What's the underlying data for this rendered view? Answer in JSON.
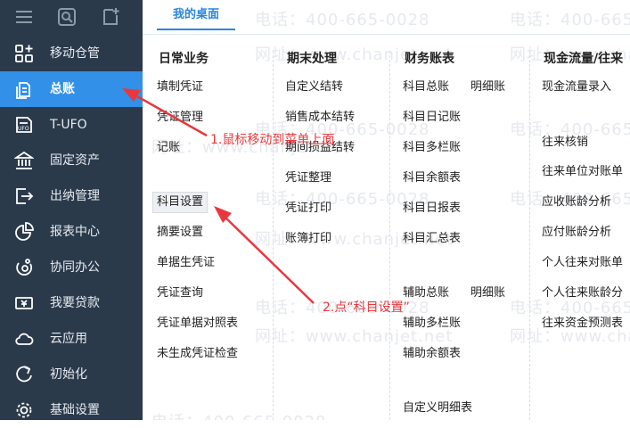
{
  "header": {
    "tab_label": "我的桌面"
  },
  "sidebar": {
    "items": [
      {
        "label": "移动仓管",
        "icon": "grid-plus-icon"
      },
      {
        "label": "总账",
        "icon": "ledger-icon",
        "active": true
      },
      {
        "label": "T-UFO",
        "icon": "ufo-icon"
      },
      {
        "label": "固定资产",
        "icon": "bank-icon"
      },
      {
        "label": "出纳管理",
        "icon": "exit-icon"
      },
      {
        "label": "报表中心",
        "icon": "pie-chart-icon"
      },
      {
        "label": "协同办公",
        "icon": "collab-icon"
      },
      {
        "label": "我要贷款",
        "icon": "money-icon"
      },
      {
        "label": "云应用",
        "icon": "cloud-icon"
      },
      {
        "label": "初始化",
        "icon": "refresh-icon"
      },
      {
        "label": "基础设置",
        "icon": "gear-icon"
      }
    ]
  },
  "columns": {
    "daily": {
      "title": "日常业务",
      "items": [
        "填制凭证",
        "凭证管理",
        "记账",
        "科目设置",
        "摘要设置",
        "单据生凭证",
        "凭证查询",
        "凭证单据对照表",
        "未生成凭证检查"
      ]
    },
    "period_end": {
      "title": "期末处理",
      "items": [
        "自定义结转",
        "销售成本结转",
        "期间损益结转",
        "凭证整理",
        "凭证打印",
        "账簿打印"
      ]
    },
    "accounts": {
      "title": "财务账表",
      "items": [
        "科目总账",
        "明细账",
        "科目日记账",
        "科目多栏账",
        "科目余额表",
        "科目日报表",
        "科目汇总表",
        "辅助总账",
        "明细账",
        "辅助多栏账",
        "辅助余额表",
        "自定义明细表"
      ]
    },
    "cashflow": {
      "title": "现金流量/往来",
      "items": [
        "现金流量录入",
        "往来核销",
        "往来单位对账单",
        "应收账龄分析",
        "应付账龄分析",
        "个人往来对账单",
        "个人往来账龄分",
        "往来资金预测表"
      ]
    }
  },
  "watermark": {
    "phone": "电话：400-665-0028",
    "site": "网址：www.chanjet.net",
    "phone_partial": "电话：400-665"
  },
  "annotations": {
    "step1": "1.鼠标移动到菜单上面",
    "step2": "2.点“科目设置”"
  },
  "colors": {
    "sidebar_bg": "#2b3a4b",
    "active_bg": "#3390e8",
    "accent": "#2a86e0",
    "annotation": "#e8383d"
  }
}
